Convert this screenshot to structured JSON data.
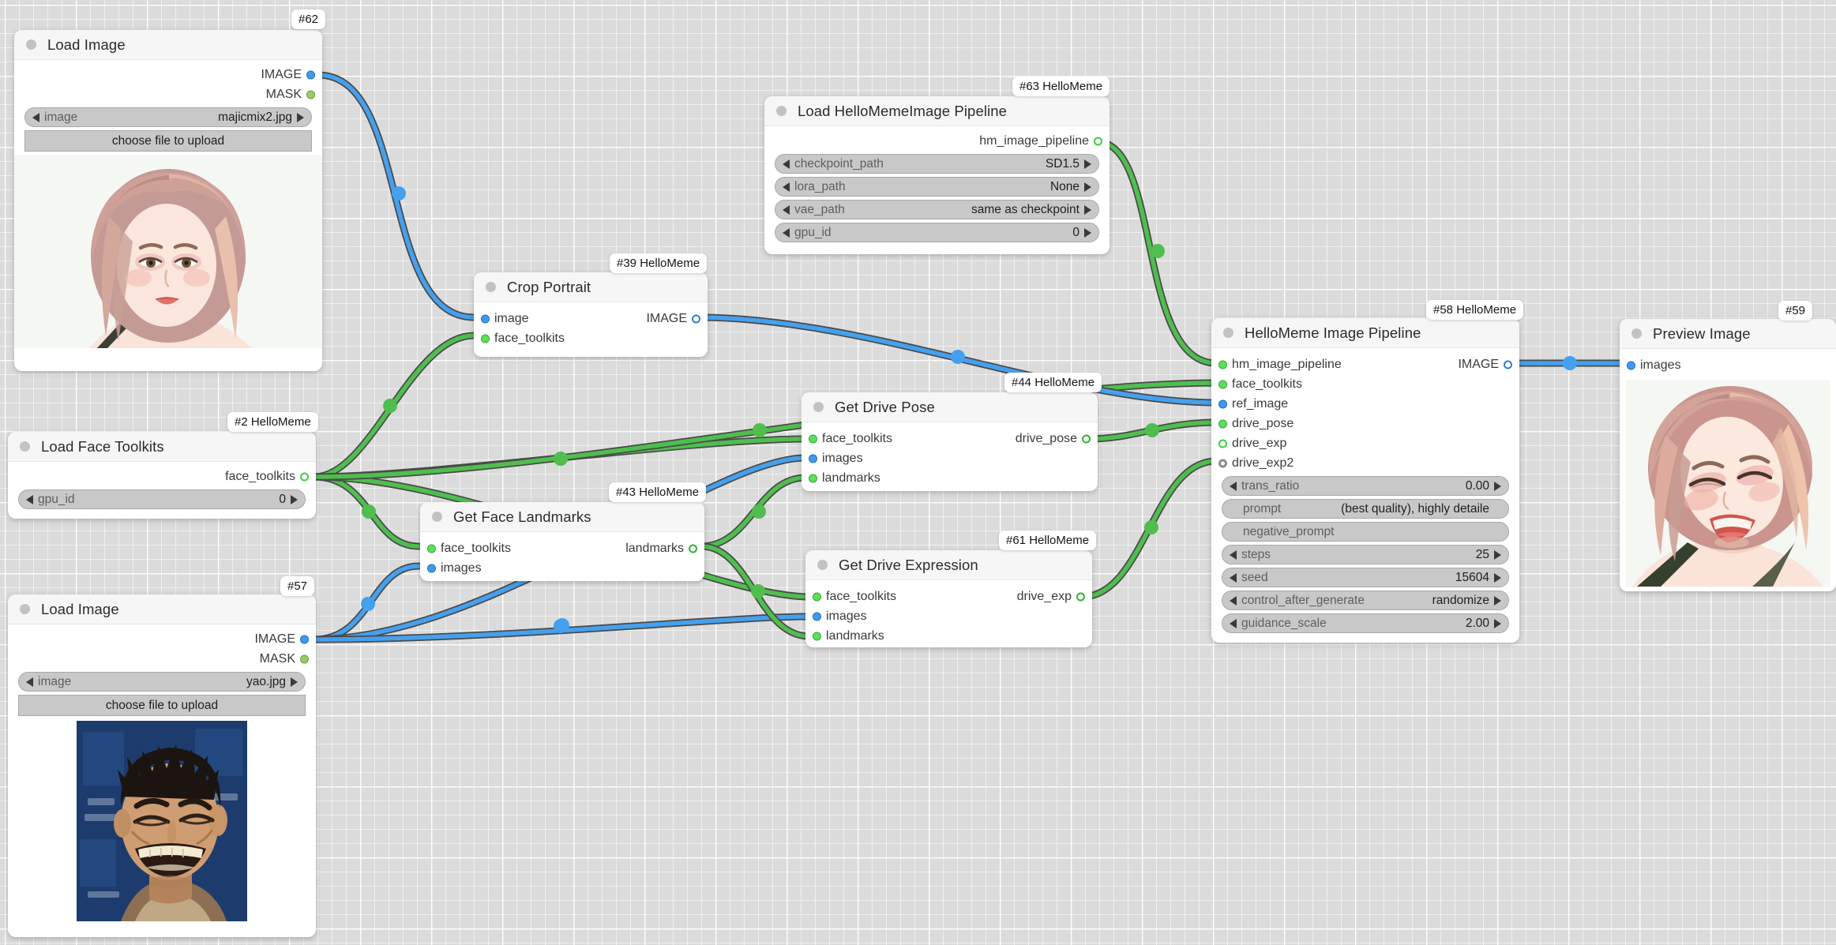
{
  "app": {
    "type": "node-graph-canvas",
    "background_color": "#dbdbdb",
    "grid": true
  },
  "wire_colors": {
    "image": "#45a0ee",
    "data": "#4fbe4f",
    "outline": "#4a4a4a"
  },
  "nodes": [
    {
      "id": "62",
      "badge": "#62",
      "title": "Load Image",
      "outputs": [
        {
          "label": "IMAGE",
          "port": "image"
        },
        {
          "label": "MASK",
          "port": "mask"
        }
      ],
      "inputs": [],
      "widgets": [
        {
          "kind": "combo",
          "label": "image",
          "value": "majicmix2.jpg"
        },
        {
          "kind": "button",
          "label": "choose file to upload"
        }
      ],
      "preview": "portrait-pink-hair"
    },
    {
      "id": "63",
      "badge": "#63 HelloMeme",
      "title": "Load HelloMemeImage Pipeline",
      "outputs": [
        {
          "label": "hm_image_pipeline",
          "port": "green-hollow"
        }
      ],
      "inputs": [],
      "widgets": [
        {
          "kind": "combo",
          "label": "checkpoint_path",
          "value": "SD1.5"
        },
        {
          "kind": "combo",
          "label": "lora_path",
          "value": "None"
        },
        {
          "kind": "combo",
          "label": "vae_path",
          "value": "same as checkpoint"
        },
        {
          "kind": "combo",
          "label": "gpu_id",
          "value": "0"
        }
      ]
    },
    {
      "id": "39",
      "badge": "#39 HelloMeme",
      "title": "Crop Portrait",
      "inputs": [
        {
          "label": "image",
          "port": "image"
        },
        {
          "label": "face_toolkits",
          "port": "green"
        }
      ],
      "outputs": [
        {
          "label": "IMAGE",
          "port": "image-hollow"
        }
      ],
      "widgets": []
    },
    {
      "id": "2",
      "badge": "#2 HelloMeme",
      "title": "Load Face Toolkits",
      "inputs": [],
      "outputs": [
        {
          "label": "face_toolkits",
          "port": "green-hollow"
        }
      ],
      "widgets": [
        {
          "kind": "combo",
          "label": "gpu_id",
          "value": "0"
        }
      ]
    },
    {
      "id": "44",
      "badge": "#44 HelloMeme",
      "title": "Get Drive Pose",
      "inputs": [
        {
          "label": "face_toolkits",
          "port": "green"
        },
        {
          "label": "images",
          "port": "image"
        },
        {
          "label": "landmarks",
          "port": "green"
        }
      ],
      "outputs": [
        {
          "label": "drive_pose",
          "port": "green-hollow"
        }
      ],
      "widgets": []
    },
    {
      "id": "43",
      "badge": "#43 HelloMeme",
      "title": "Get Face Landmarks",
      "inputs": [
        {
          "label": "face_toolkits",
          "port": "green"
        },
        {
          "label": "images",
          "port": "image"
        }
      ],
      "outputs": [
        {
          "label": "landmarks",
          "port": "green-hollow"
        }
      ],
      "widgets": []
    },
    {
      "id": "61",
      "badge": "#61 HelloMeme",
      "title": "Get Drive Expression",
      "inputs": [
        {
          "label": "face_toolkits",
          "port": "green"
        },
        {
          "label": "images",
          "port": "image"
        },
        {
          "label": "landmarks",
          "port": "green"
        }
      ],
      "outputs": [
        {
          "label": "drive_exp",
          "port": "green-hollow"
        }
      ],
      "widgets": []
    },
    {
      "id": "57",
      "badge": "#57",
      "title": "Load Image",
      "inputs": [],
      "outputs": [
        {
          "label": "IMAGE",
          "port": "image"
        },
        {
          "label": "MASK",
          "port": "mask"
        }
      ],
      "widgets": [
        {
          "kind": "combo",
          "label": "image",
          "value": "yao.jpg"
        },
        {
          "kind": "button",
          "label": "choose file to upload"
        }
      ],
      "preview": "portrait-laughing-man"
    },
    {
      "id": "58",
      "badge": "#58 HelloMeme",
      "title": "HelloMeme Image Pipeline",
      "inputs": [
        {
          "label": "hm_image_pipeline",
          "port": "green"
        },
        {
          "label": "face_toolkits",
          "port": "green"
        },
        {
          "label": "ref_image",
          "port": "image"
        },
        {
          "label": "drive_pose",
          "port": "green"
        },
        {
          "label": "drive_exp",
          "port": "green-hollow"
        },
        {
          "label": "drive_exp2",
          "port": "grey-hollow"
        }
      ],
      "outputs": [
        {
          "label": "IMAGE",
          "port": "image-hollow"
        }
      ],
      "widgets": [
        {
          "kind": "number",
          "label": "trans_ratio",
          "value": "0.00"
        },
        {
          "kind": "text",
          "label": "prompt",
          "value": "(best quality), highly detaile"
        },
        {
          "kind": "text",
          "label": "negative_prompt",
          "value": ""
        },
        {
          "kind": "number",
          "label": "steps",
          "value": "25"
        },
        {
          "kind": "number",
          "label": "seed",
          "value": "15604"
        },
        {
          "kind": "combo",
          "label": "control_after_generate",
          "value": "randomize"
        },
        {
          "kind": "number",
          "label": "guidance_scale",
          "value": "2.00"
        }
      ]
    },
    {
      "id": "59",
      "badge": "#59",
      "title": "Preview Image",
      "inputs": [
        {
          "label": "images",
          "port": "image"
        }
      ],
      "outputs": [],
      "widgets": [],
      "preview": "portrait-pink-hair-smiling"
    }
  ]
}
